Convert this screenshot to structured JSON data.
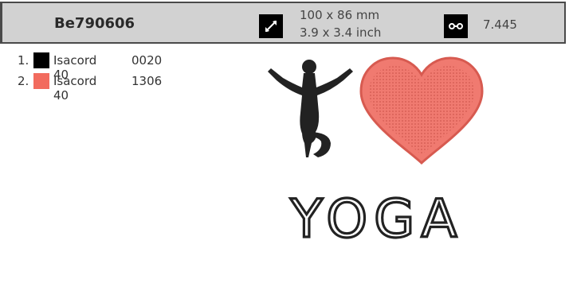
{
  "header": {
    "design_id": "Be790606",
    "size_icon": "resize-arrows-icon",
    "size_mm": "100 x 86 mm",
    "size_inch": "3.9 x 3.4 inch",
    "stitch_icon": "stitch-icon",
    "stitch_count": "7.445"
  },
  "threads": [
    {
      "number": "1.",
      "color": "#000000",
      "brand": "Isacord 40",
      "code": "0020"
    },
    {
      "number": "2.",
      "color": "#f26b5e",
      "brand": "Isacord 40",
      "code": "1306"
    }
  ],
  "design": {
    "text": "YOGA",
    "heart_color": "#f26b5e",
    "silhouette_color": "#222222"
  }
}
